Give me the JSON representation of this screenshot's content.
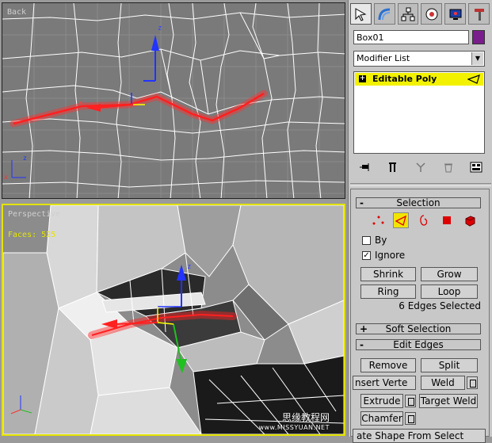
{
  "viewports": {
    "back": {
      "label": "Back"
    },
    "perspective": {
      "label": "Perspective",
      "faces": "Faces: 525"
    }
  },
  "watermark": {
    "line1": "思缘教程网",
    "line2": "www.MISSYUAN.NET"
  },
  "command_panel": {
    "tabs": [
      "create-icon",
      "modify-icon",
      "hierarchy-icon",
      "motion-icon",
      "display-icon",
      "utilities-icon"
    ],
    "object_name": "Box01",
    "object_color": "#7a1d8c",
    "modifier_list": "Modifier List",
    "stack": [
      {
        "label": "Editable Poly",
        "expander": "+"
      }
    ],
    "stack_tools": [
      "pin-stack-icon",
      "show-end-result-icon",
      "make-unique-icon",
      "remove-modifier-icon",
      "configure-modifier-sets-icon"
    ]
  },
  "selection": {
    "title": "Selection",
    "levels": [
      "vertex",
      "edge",
      "border",
      "polygon",
      "element"
    ],
    "active_level": "edge",
    "by_label": "By",
    "by_checked": false,
    "ignore_label": "Ignore",
    "ignore_checked": true,
    "shrink": "Shrink",
    "grow": "Grow",
    "ring": "Ring",
    "loop": "Loop",
    "status": "6 Edges Selected"
  },
  "soft_selection": {
    "expander": "+",
    "title": "Soft Selection"
  },
  "edit_edges": {
    "expander": "-",
    "title": "Edit Edges",
    "remove": "Remove",
    "split": "Split",
    "insert_vertex": "nsert Verte",
    "weld": "Weld",
    "extrude": "Extrude",
    "target_weld": "Target Weld",
    "chamfer": "Chamfer",
    "create_shape": "ate Shape From Select"
  },
  "colors": {
    "highlight": "#f2f200",
    "selection_glow": "#ff2020",
    "viewport_active_border": "#e3e300"
  }
}
